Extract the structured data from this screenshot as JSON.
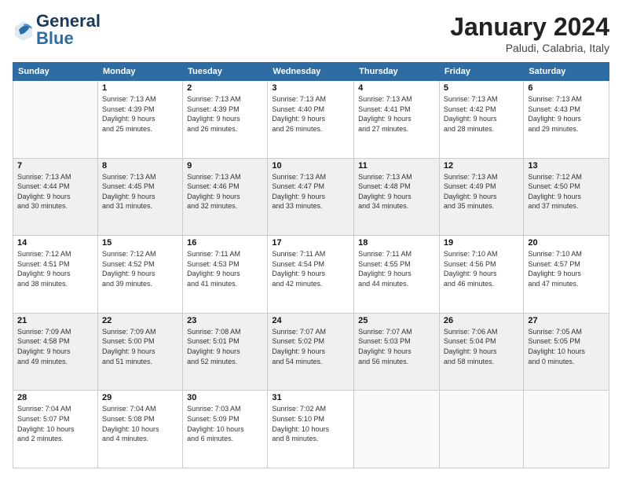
{
  "header": {
    "logo_general": "General",
    "logo_blue": "Blue",
    "month_title": "January 2024",
    "location": "Paludi, Calabria, Italy"
  },
  "weekdays": [
    "Sunday",
    "Monday",
    "Tuesday",
    "Wednesday",
    "Thursday",
    "Friday",
    "Saturday"
  ],
  "weeks": [
    [
      {
        "day": "",
        "info": ""
      },
      {
        "day": "1",
        "info": "Sunrise: 7:13 AM\nSunset: 4:39 PM\nDaylight: 9 hours\nand 25 minutes."
      },
      {
        "day": "2",
        "info": "Sunrise: 7:13 AM\nSunset: 4:39 PM\nDaylight: 9 hours\nand 26 minutes."
      },
      {
        "day": "3",
        "info": "Sunrise: 7:13 AM\nSunset: 4:40 PM\nDaylight: 9 hours\nand 26 minutes."
      },
      {
        "day": "4",
        "info": "Sunrise: 7:13 AM\nSunset: 4:41 PM\nDaylight: 9 hours\nand 27 minutes."
      },
      {
        "day": "5",
        "info": "Sunrise: 7:13 AM\nSunset: 4:42 PM\nDaylight: 9 hours\nand 28 minutes."
      },
      {
        "day": "6",
        "info": "Sunrise: 7:13 AM\nSunset: 4:43 PM\nDaylight: 9 hours\nand 29 minutes."
      }
    ],
    [
      {
        "day": "7",
        "info": "Sunrise: 7:13 AM\nSunset: 4:44 PM\nDaylight: 9 hours\nand 30 minutes."
      },
      {
        "day": "8",
        "info": "Sunrise: 7:13 AM\nSunset: 4:45 PM\nDaylight: 9 hours\nand 31 minutes."
      },
      {
        "day": "9",
        "info": "Sunrise: 7:13 AM\nSunset: 4:46 PM\nDaylight: 9 hours\nand 32 minutes."
      },
      {
        "day": "10",
        "info": "Sunrise: 7:13 AM\nSunset: 4:47 PM\nDaylight: 9 hours\nand 33 minutes."
      },
      {
        "day": "11",
        "info": "Sunrise: 7:13 AM\nSunset: 4:48 PM\nDaylight: 9 hours\nand 34 minutes."
      },
      {
        "day": "12",
        "info": "Sunrise: 7:13 AM\nSunset: 4:49 PM\nDaylight: 9 hours\nand 35 minutes."
      },
      {
        "day": "13",
        "info": "Sunrise: 7:12 AM\nSunset: 4:50 PM\nDaylight: 9 hours\nand 37 minutes."
      }
    ],
    [
      {
        "day": "14",
        "info": "Sunrise: 7:12 AM\nSunset: 4:51 PM\nDaylight: 9 hours\nand 38 minutes."
      },
      {
        "day": "15",
        "info": "Sunrise: 7:12 AM\nSunset: 4:52 PM\nDaylight: 9 hours\nand 39 minutes."
      },
      {
        "day": "16",
        "info": "Sunrise: 7:11 AM\nSunset: 4:53 PM\nDaylight: 9 hours\nand 41 minutes."
      },
      {
        "day": "17",
        "info": "Sunrise: 7:11 AM\nSunset: 4:54 PM\nDaylight: 9 hours\nand 42 minutes."
      },
      {
        "day": "18",
        "info": "Sunrise: 7:11 AM\nSunset: 4:55 PM\nDaylight: 9 hours\nand 44 minutes."
      },
      {
        "day": "19",
        "info": "Sunrise: 7:10 AM\nSunset: 4:56 PM\nDaylight: 9 hours\nand 46 minutes."
      },
      {
        "day": "20",
        "info": "Sunrise: 7:10 AM\nSunset: 4:57 PM\nDaylight: 9 hours\nand 47 minutes."
      }
    ],
    [
      {
        "day": "21",
        "info": "Sunrise: 7:09 AM\nSunset: 4:58 PM\nDaylight: 9 hours\nand 49 minutes."
      },
      {
        "day": "22",
        "info": "Sunrise: 7:09 AM\nSunset: 5:00 PM\nDaylight: 9 hours\nand 51 minutes."
      },
      {
        "day": "23",
        "info": "Sunrise: 7:08 AM\nSunset: 5:01 PM\nDaylight: 9 hours\nand 52 minutes."
      },
      {
        "day": "24",
        "info": "Sunrise: 7:07 AM\nSunset: 5:02 PM\nDaylight: 9 hours\nand 54 minutes."
      },
      {
        "day": "25",
        "info": "Sunrise: 7:07 AM\nSunset: 5:03 PM\nDaylight: 9 hours\nand 56 minutes."
      },
      {
        "day": "26",
        "info": "Sunrise: 7:06 AM\nSunset: 5:04 PM\nDaylight: 9 hours\nand 58 minutes."
      },
      {
        "day": "27",
        "info": "Sunrise: 7:05 AM\nSunset: 5:05 PM\nDaylight: 10 hours\nand 0 minutes."
      }
    ],
    [
      {
        "day": "28",
        "info": "Sunrise: 7:04 AM\nSunset: 5:07 PM\nDaylight: 10 hours\nand 2 minutes."
      },
      {
        "day": "29",
        "info": "Sunrise: 7:04 AM\nSunset: 5:08 PM\nDaylight: 10 hours\nand 4 minutes."
      },
      {
        "day": "30",
        "info": "Sunrise: 7:03 AM\nSunset: 5:09 PM\nDaylight: 10 hours\nand 6 minutes."
      },
      {
        "day": "31",
        "info": "Sunrise: 7:02 AM\nSunset: 5:10 PM\nDaylight: 10 hours\nand 8 minutes."
      },
      {
        "day": "",
        "info": ""
      },
      {
        "day": "",
        "info": ""
      },
      {
        "day": "",
        "info": ""
      }
    ]
  ]
}
